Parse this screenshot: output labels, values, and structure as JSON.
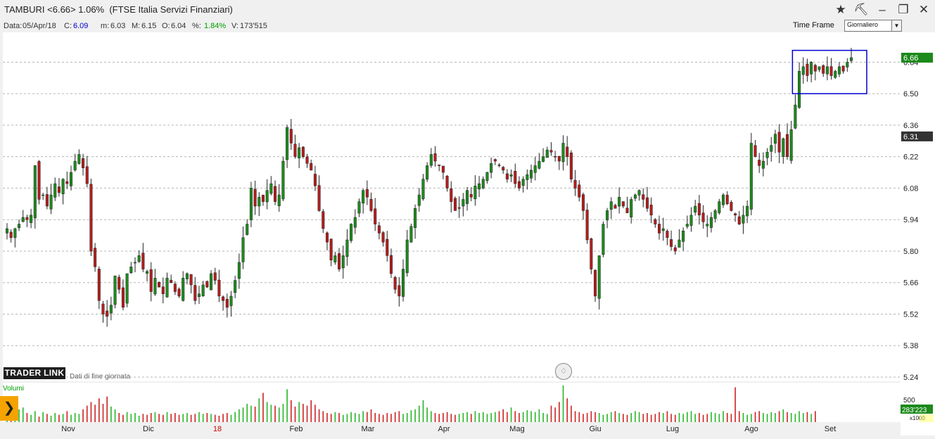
{
  "window": {
    "title": "TAMBURI <6.66> 1.06%  (FTSE Italia Servizi Finanziari)"
  },
  "infobar": {
    "date_label": "Data:",
    "date": "05/Apr/18",
    "close_label": "C:",
    "close": "6.09",
    "min_label": "m:",
    "min": "6.03",
    "max_label": "M:",
    "max": "6.15",
    "open_label": "O:",
    "open": "6.04",
    "pct_label": "%:",
    "pct": "1.84%",
    "vol_label": "V:",
    "vol": "173'515"
  },
  "timeframe": {
    "label": "Time Frame",
    "value": "Giornaliero"
  },
  "branding": {
    "logo": "TRADER LINK",
    "subtitle": "Dati di fine giornata"
  },
  "volume_panel": {
    "label": "Volumi",
    "scale_label": "500",
    "current_value": "283'223",
    "multiplier": "x1000"
  },
  "colors": {
    "up": "#1f8a1f",
    "down": "#b21f1f",
    "highlight_box": "#0000cc",
    "last_price_bg": "#1c8a1c",
    "ref_price_bg": "#333333"
  },
  "chart_data": {
    "type": "candlestick",
    "y_ticks": [
      "6.64",
      "6.50",
      "6.36",
      "6.22",
      "6.08",
      "5.94",
      "5.80",
      "5.66",
      "5.52",
      "5.38",
      "5.24"
    ],
    "ylim": [
      5.24,
      6.71
    ],
    "x_labels": [
      "Nov",
      "Dic",
      "18",
      "Feb",
      "Mar",
      "Apr",
      "Mag",
      "Giu",
      "Lug",
      "Ago",
      "Set"
    ],
    "last_price": "6.66",
    "ref_price": "6.31",
    "highlight_range": [
      6.5,
      6.68
    ],
    "closes": [
      5.9,
      5.86,
      5.9,
      5.92,
      5.95,
      5.94,
      5.96,
      6.18,
      6.03,
      6.05,
      6.0,
      6.05,
      6.1,
      6.06,
      6.12,
      6.1,
      6.15,
      6.2,
      6.23,
      6.17,
      6.1,
      5.8,
      5.73,
      5.58,
      5.52,
      5.51,
      5.56,
      5.69,
      5.63,
      5.55,
      5.7,
      5.73,
      5.75,
      5.78,
      5.72,
      5.71,
      5.62,
      5.68,
      5.64,
      5.61,
      5.68,
      5.66,
      5.62,
      5.6,
      5.68,
      5.7,
      5.65,
      5.58,
      5.61,
      5.65,
      5.64,
      5.7,
      5.67,
      5.6,
      5.58,
      5.55,
      5.6,
      5.67,
      5.75,
      5.86,
      5.92,
      6.08,
      6.0,
      6.04,
      6.02,
      6.07,
      6.1,
      6.02,
      6.05,
      6.2,
      6.35,
      6.28,
      6.22,
      6.26,
      6.22,
      6.19,
      6.16,
      6.09,
      5.98,
      5.9,
      5.84,
      5.76,
      5.78,
      5.72,
      5.78,
      5.85,
      5.92,
      5.95,
      6.02,
      6.07,
      6.04,
      5.98,
      5.92,
      5.88,
      5.84,
      5.78,
      5.7,
      5.63,
      5.6,
      5.72,
      5.85,
      5.91,
      5.99,
      6.05,
      6.12,
      6.18,
      6.23,
      6.2,
      6.18,
      6.15,
      6.08,
      6.02,
      5.98,
      5.99,
      6.03,
      6.07,
      6.04,
      6.09,
      6.1,
      6.12,
      6.15,
      6.19,
      6.2,
      6.18,
      6.16,
      6.12,
      6.14,
      6.1,
      6.08,
      6.12,
      6.14,
      6.16,
      6.18,
      6.2,
      6.22,
      6.25,
      6.24,
      6.22,
      6.2,
      6.28,
      6.22,
      6.12,
      6.08,
      6.04,
      5.98,
      5.85,
      5.72,
      5.6,
      5.78,
      5.92,
      5.98,
      6.02,
      5.99,
      6.04,
      6.0,
      5.97,
      6.03,
      6.05,
      6.07,
      6.03,
      5.99,
      5.96,
      5.92,
      5.88,
      5.9,
      5.86,
      5.82,
      5.8,
      5.85,
      5.89,
      5.92,
      5.96,
      6.0,
      5.96,
      5.93,
      5.92,
      5.95,
      5.98,
      6.02,
      6.05,
      6.01,
      5.98,
      5.96,
      5.92,
      5.96,
      6.0,
      6.28,
      6.22,
      6.18,
      6.2,
      6.24,
      6.27,
      6.32,
      6.24,
      6.3,
      6.22,
      6.34,
      6.45,
      6.6,
      6.62,
      6.58,
      6.64,
      6.6,
      6.62,
      6.59,
      6.62,
      6.58,
      6.6,
      6.62,
      6.6,
      6.64,
      6.66
    ],
    "volumes": [
      40,
      30,
      50,
      70,
      80,
      50,
      40,
      60,
      30,
      55,
      45,
      35,
      50,
      40,
      45,
      60,
      40,
      50,
      45,
      70,
      90,
      110,
      95,
      130,
      100,
      140,
      85,
      70,
      50,
      40,
      55,
      45,
      50,
      35,
      45,
      40,
      50,
      55,
      45,
      40,
      55,
      45,
      50,
      40,
      45,
      50,
      40,
      45,
      55,
      45,
      50,
      45,
      40,
      35,
      45,
      50,
      40,
      55,
      70,
      80,
      100,
      90,
      85,
      130,
      160,
      110,
      95,
      90,
      80,
      100,
      180,
      120,
      85,
      110,
      100,
      90,
      120,
      95,
      70,
      60,
      50,
      45,
      55,
      50,
      40,
      45,
      55,
      50,
      45,
      60,
      55,
      70,
      50,
      45,
      40,
      50,
      45,
      55,
      60,
      45,
      50,
      65,
      70,
      90,
      120,
      80,
      60,
      50,
      45,
      50,
      55,
      45,
      40,
      45,
      50,
      55,
      45,
      60,
      50,
      55,
      45,
      50,
      55,
      60,
      70,
      55,
      80,
      60,
      50,
      55,
      65,
      60,
      55,
      70,
      50,
      45,
      90,
      80,
      110,
      200,
      130,
      90,
      60,
      55,
      45,
      50,
      60,
      55,
      50,
      40,
      45,
      55,
      60,
      50,
      45,
      40,
      50,
      60,
      55,
      45,
      50,
      40,
      45,
      55,
      50,
      60,
      45,
      40,
      50,
      45,
      55,
      60,
      45,
      50,
      40,
      45,
      55,
      50,
      45,
      60,
      50,
      45,
      190,
      60,
      50,
      40,
      45,
      55,
      60,
      50,
      45,
      55,
      50,
      60,
      70,
      55,
      50,
      45,
      60,
      50,
      55,
      45,
      60
    ]
  }
}
